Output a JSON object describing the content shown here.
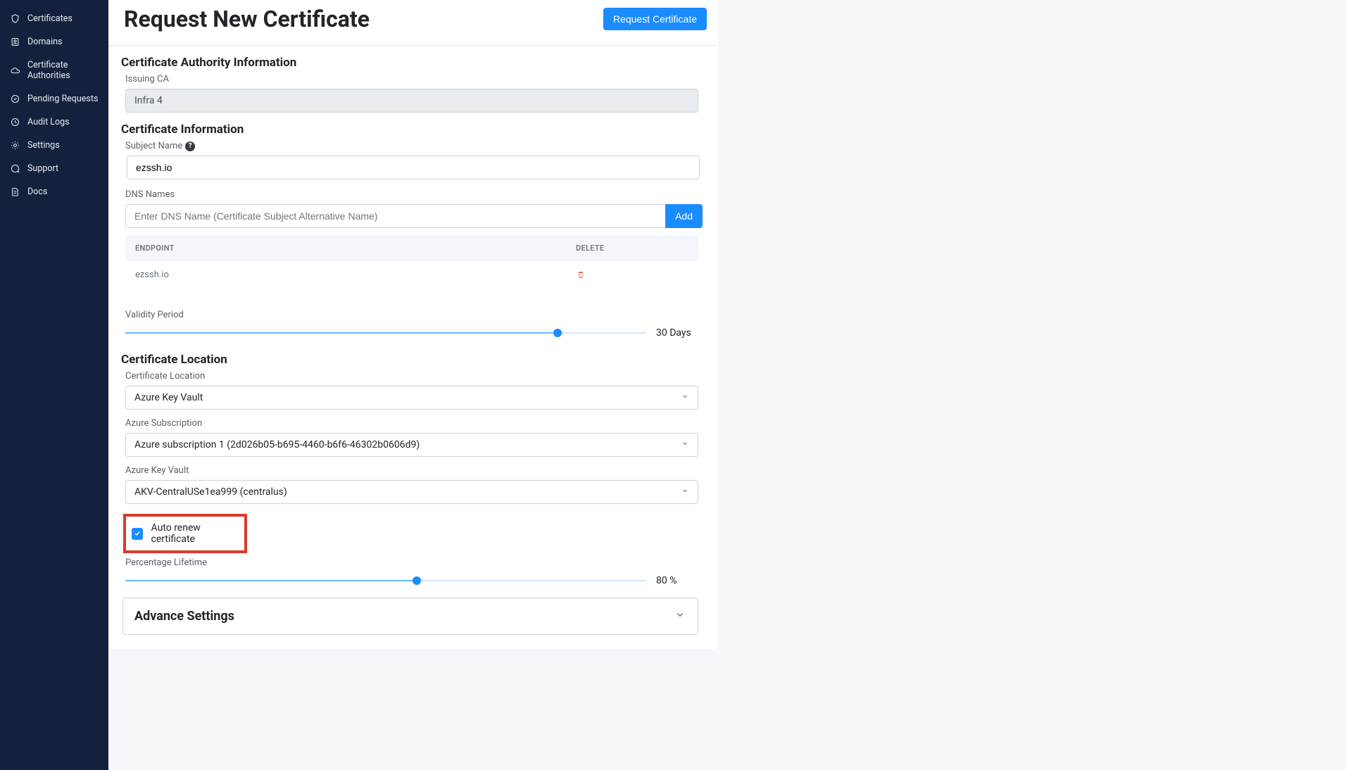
{
  "sidebar": {
    "items": [
      {
        "label": "Certificates"
      },
      {
        "label": "Domains"
      },
      {
        "label": "Certificate Authorities"
      },
      {
        "label": "Pending Requests"
      },
      {
        "label": "Audit Logs"
      },
      {
        "label": "Settings"
      },
      {
        "label": "Support"
      },
      {
        "label": "Docs"
      }
    ]
  },
  "header": {
    "title": "Request New Certificate",
    "action_label": "Request Certificate"
  },
  "ca_section": {
    "heading": "Certificate Authority Information",
    "issuing_ca_label": "Issuing CA",
    "issuing_ca_value": "Infra 4"
  },
  "cert_info": {
    "heading": "Certificate Information",
    "subject_label": "Subject Name",
    "subject_value": "ezssh.io",
    "dns_label": "DNS Names",
    "dns_placeholder": "Enter DNS Name (Certificate Subject Alternative Name)",
    "add_button": "Add",
    "table": {
      "col_endpoint": "ENDPOINT",
      "col_delete": "DELETE",
      "rows": [
        {
          "endpoint": "ezssh.io"
        }
      ]
    },
    "validity_label": "Validity Period",
    "validity_value": "30 Days",
    "validity_percent": 83
  },
  "location": {
    "heading": "Certificate Location",
    "loc_label": "Certificate Location",
    "loc_value": "Azure Key Vault",
    "sub_label": "Azure Subscription",
    "sub_value": "Azure subscription 1 (2d026b05-b695-4460-b6f6-46302b0606d9)",
    "kv_label": "Azure Key Vault",
    "kv_value": "AKV-CentralUSe1ea999 (centralus)",
    "autorenew_label": "Auto renew certificate",
    "autorenew_checked": true,
    "pct_label": "Percentage Lifetime",
    "pct_value": "80 %",
    "pct_percent": 56
  },
  "advance": {
    "heading": "Advance Settings"
  }
}
